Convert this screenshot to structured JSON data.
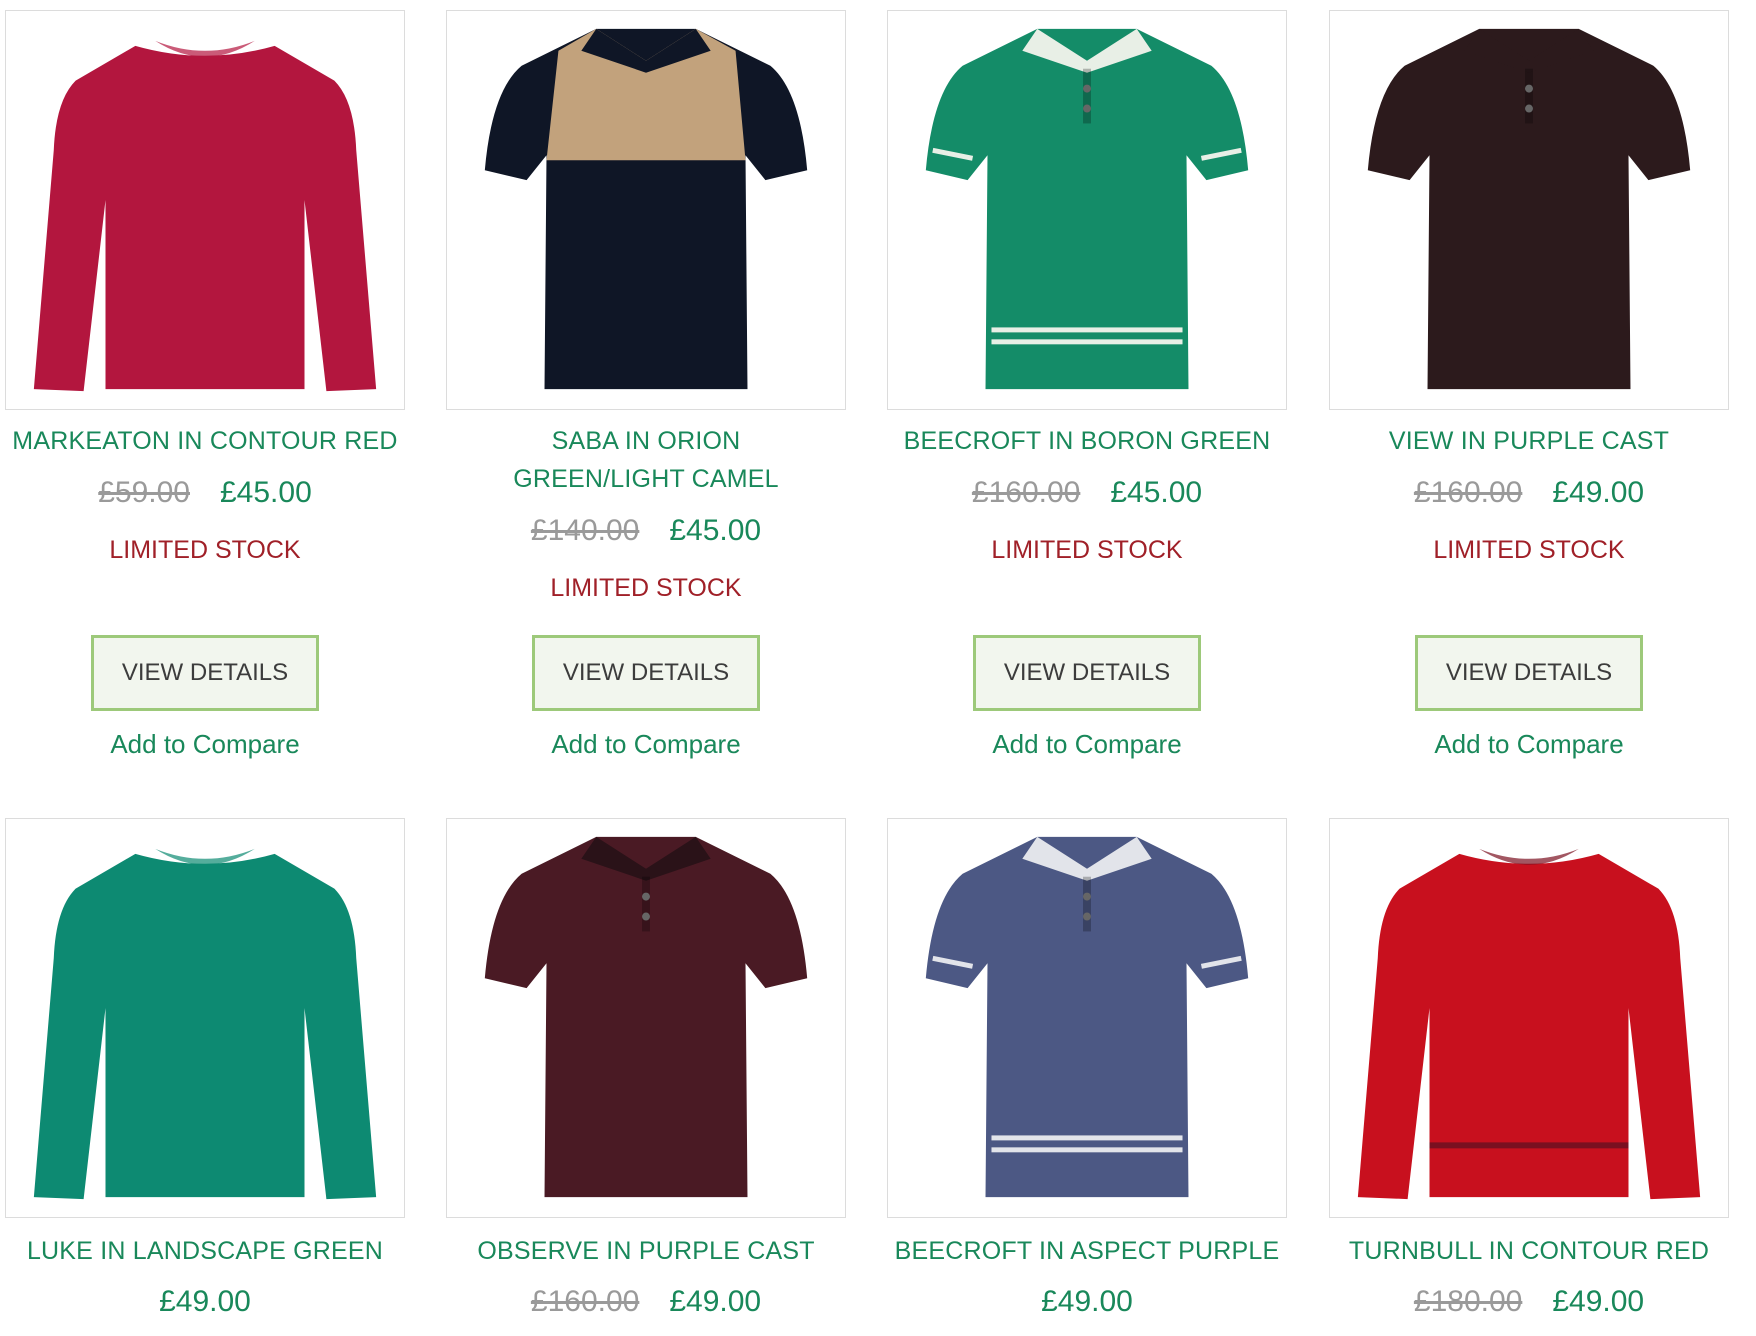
{
  "products": [
    {
      "name": "MARKEATON IN CONTOUR RED",
      "old_price": "£59.00",
      "price": "£45.00",
      "stock": "LIMITED STOCK",
      "button": "VIEW DETAILS",
      "compare": "Add to Compare",
      "garment": "sweater",
      "color": "#b3163e",
      "trim": "#b3163e"
    },
    {
      "name": "SABA IN ORION GREEN/LIGHT CAMEL",
      "old_price": "£140.00",
      "price": "£45.00",
      "stock": "LIMITED STOCK",
      "button": "VIEW DETAILS",
      "compare": "Add to Compare",
      "garment": "polo-block",
      "color": "#0f1626",
      "trim": "#c2a27c"
    },
    {
      "name": "BEECROFT IN BORON GREEN",
      "old_price": "£160.00",
      "price": "£45.00",
      "stock": "LIMITED STOCK",
      "button": "VIEW DETAILS",
      "compare": "Add to Compare",
      "garment": "polo-stripe",
      "color": "#148c68",
      "trim": "#e8efe6"
    },
    {
      "name": "VIEW IN PURPLE CAST",
      "old_price": "£160.00",
      "price": "£49.00",
      "stock": "LIMITED STOCK",
      "button": "VIEW DETAILS",
      "compare": "Add to Compare",
      "garment": "polo",
      "color": "#2c1a1c",
      "trim": "#2c1a1c"
    },
    {
      "name": "LUKE IN LANDSCAPE GREEN",
      "old_price": "",
      "price": "£49.00",
      "stock": "",
      "button": "",
      "compare": "",
      "garment": "sweater",
      "color": "#0d8a72",
      "trim": "#0d8a72"
    },
    {
      "name": "OBSERVE IN PURPLE CAST",
      "old_price": "£160.00",
      "price": "£49.00",
      "stock": "",
      "button": "",
      "compare": "",
      "garment": "polo",
      "color": "#4a1a24",
      "trim": "#2a1218"
    },
    {
      "name": "BEECROFT IN ASPECT PURPLE",
      "old_price": "",
      "price": "£49.00",
      "stock": "",
      "button": "",
      "compare": "",
      "garment": "polo-stripe",
      "color": "#4c5884",
      "trim": "#e2e4ea"
    },
    {
      "name": "TURNBULL IN CONTOUR RED",
      "old_price": "£180.00",
      "price": "£49.00",
      "stock": "",
      "button": "",
      "compare": "",
      "garment": "sweater",
      "color": "#c8101e",
      "trim": "#7a1020"
    }
  ]
}
